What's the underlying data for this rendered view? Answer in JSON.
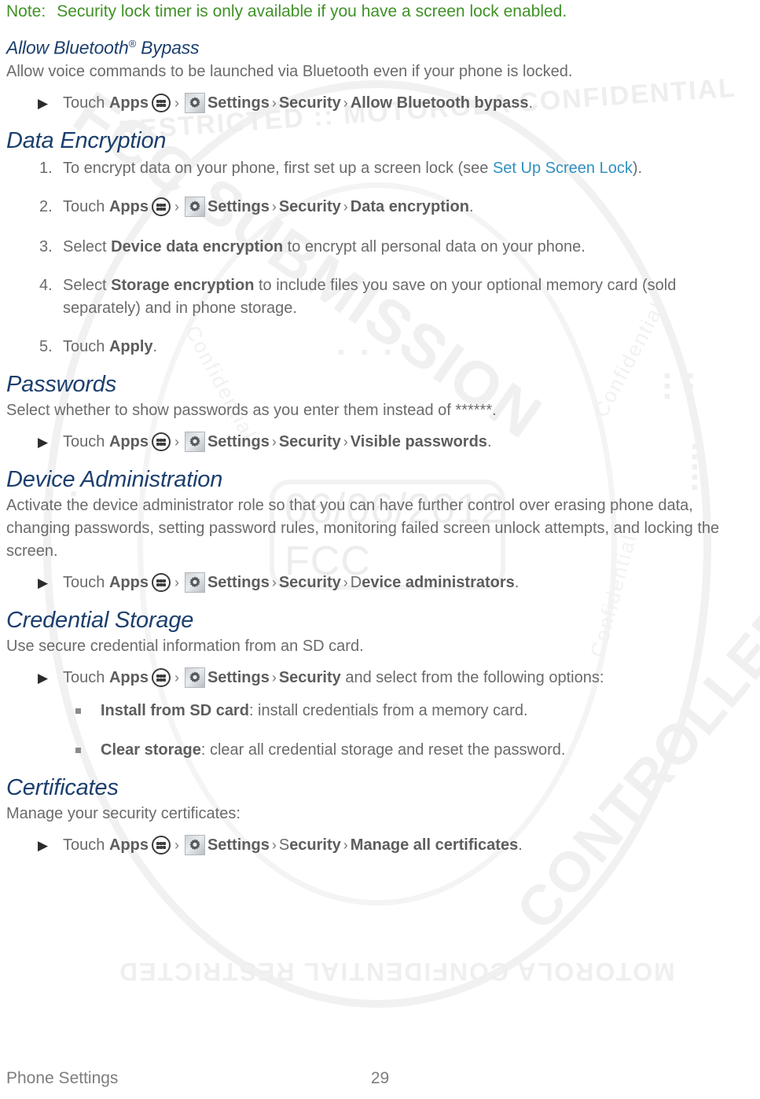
{
  "colors": {
    "note_green": "#3f9226",
    "heading_navy": "#1c3f6e",
    "xref_blue": "#2f90bf",
    "body_gray": "#6b6b6b"
  },
  "note": {
    "label": "Note:",
    "text": "Security lock timer is only available if you have a screen lock enabled."
  },
  "sections": {
    "allow_bluetooth_bypass": {
      "heading_pre": "Allow Bluetooth",
      "heading_sup": "®",
      "heading_post": " Bypass",
      "intro": "Allow voice commands to be launched via Bluetooth even if your phone is locked.",
      "step": {
        "touch": "Touch",
        "apps": "Apps",
        "settings": "Settings",
        "security": "Security",
        "target": "Allow Bluetooth bypass",
        "period": "."
      }
    },
    "data_encryption": {
      "heading": "Data Encryption",
      "steps": [
        {
          "num": "1.",
          "pre": "To encrypt data on your phone, first set up a screen lock (see ",
          "xref": "Set Up Screen Lock",
          "post": ")."
        },
        {
          "num": "2.",
          "touch": "Touch",
          "apps": "Apps",
          "settings": "Settings",
          "security": "Security",
          "target": "Data encryption",
          "period": "."
        },
        {
          "num": "3.",
          "pre": "Select ",
          "bold": "Device data encryption",
          "post": " to encrypt all personal data on your phone."
        },
        {
          "num": "4.",
          "pre": "Select ",
          "bold": "Storage encryption",
          "post": " to include files you save on your optional memory card (sold separately) and in phone storage."
        },
        {
          "num": "5.",
          "pre": "Touch ",
          "bold": "Apply",
          "post": "."
        }
      ]
    },
    "passwords": {
      "heading": "Passwords",
      "intro": "Select whether to show passwords as you enter them instead of ******.",
      "step": {
        "touch": "Touch",
        "apps": "Apps",
        "settings": "Settings",
        "security": "Security",
        "target": "Visible passwords",
        "period": "."
      }
    },
    "device_administration": {
      "heading": "Device Administration",
      "intro": "Activate the device administrator role so that you can have further control over erasing phone data, changing passwords, setting password rules, monitoring failed screen unlock attempts, and locking the screen.",
      "step": {
        "touch": "Touch",
        "apps": "Apps",
        "settings": "Settings",
        "security": "Security",
        "target_lead": "D",
        "target": "evice administrators",
        "period": "."
      }
    },
    "credential_storage": {
      "heading": "Credential Storage",
      "intro": "Use secure credential information from an SD card.",
      "step": {
        "touch": "Touch",
        "apps": "Apps",
        "settings": "Settings",
        "security": "Security",
        "tail": " and select from the following options:"
      },
      "options": [
        {
          "bold": "Install from SD card",
          "text": ": install credentials from a memory card."
        },
        {
          "bold": "Clear storage",
          "text": ": clear all credential storage and reset the password."
        }
      ]
    },
    "certificates": {
      "heading": "Certificates",
      "intro": "Manage your security certificates:",
      "step": {
        "touch": "Touch",
        "apps": "Apps",
        "settings": "Settings",
        "security_lead": "S",
        "security": "ecurity",
        "target": "Manage all certificates",
        "period": "."
      }
    }
  },
  "footer": {
    "left": "Phone Settings",
    "page": "29"
  },
  "watermarks": {
    "date": "06/06/2012",
    "agency": "FCC",
    "ring_top": "RESTRICTED :: MOTOROLA CONFIDENTIAL",
    "ring_bottom": "MOTOROLA CONFIDENTIAL RESTRICTED",
    "arc_left": "FCC SUBMISSION",
    "arc_right": "CONTROLLED",
    "side_text": "Confidential"
  },
  "icons": {
    "apps": "apps-grid-icon",
    "settings": "gear-icon",
    "arrow_bullet": "▶",
    "chevron": "›"
  }
}
